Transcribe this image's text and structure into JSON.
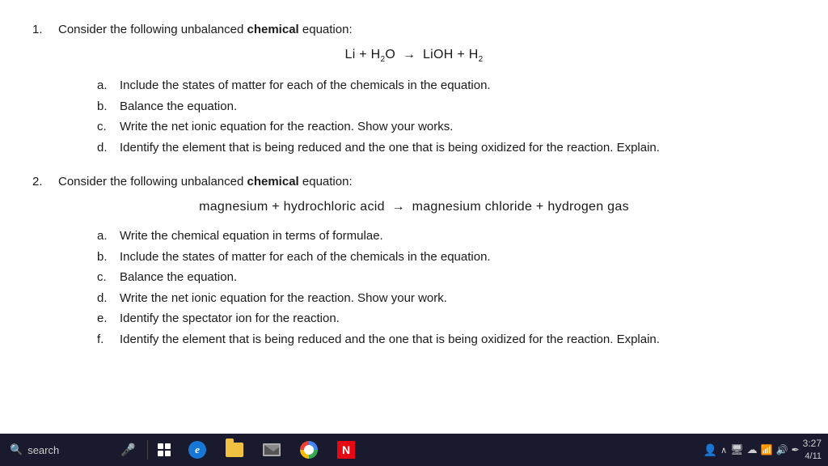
{
  "content": {
    "questions": [
      {
        "number": "1.",
        "intro_text_before": "Consider the following unbalanced ",
        "bold_word": "chemical",
        "intro_text_after": " equation:",
        "equation": "Li + H₂O → LiOH + H₂",
        "equation_parts": {
          "left": "Li + H",
          "left_sub": "2",
          "left_after": "O",
          "arrow": "→",
          "right": "LiOH + H",
          "right_sub": "2"
        },
        "sub_items": [
          {
            "label": "a.",
            "text": "Include the states of matter for each of the chemicals in the equation."
          },
          {
            "label": "b.",
            "text": "Balance the equation."
          },
          {
            "label": "c.",
            "text": "Write the net ionic equation for the reaction. Show your works."
          },
          {
            "label": "d.",
            "text": "Identify the element that is being reduced and the one that is being oxidized for the reaction. Explain."
          }
        ]
      },
      {
        "number": "2.",
        "intro_text_before": "Consider the following unbalanced ",
        "bold_word": "chemical",
        "intro_text_after": " equation:",
        "equation": "magnesium + hydrochloric acid → magnesium chloride + hydrogen gas",
        "sub_items": [
          {
            "label": "a.",
            "text": "Write the chemical equation in terms of formulae."
          },
          {
            "label": "b.",
            "text": "Include the states of matter for each of the chemicals in the equation."
          },
          {
            "label": "c.",
            "text": "Balance the equation."
          },
          {
            "label": "d.",
            "text": "Write the net ionic equation for the reaction. Show your work."
          },
          {
            "label": "e.",
            "text": "Identify the spectator ion for the reaction."
          },
          {
            "label": "f.",
            "text": "Identify the element that is being reduced and the one that is being oxidized for the reaction. Explain."
          }
        ]
      }
    ]
  },
  "taskbar": {
    "search_label": "search",
    "time": "3:27",
    "date": "4/11"
  }
}
